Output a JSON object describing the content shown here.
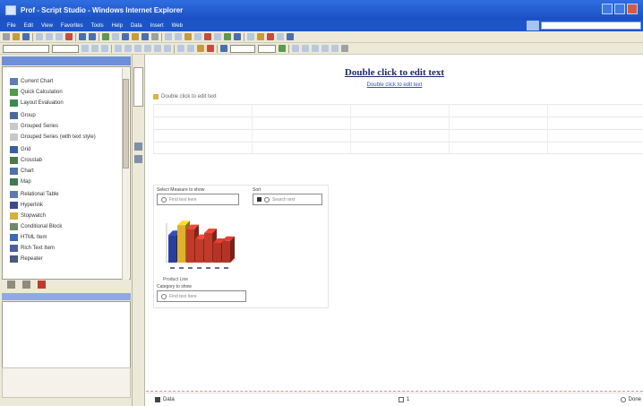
{
  "window": {
    "title": "Prof - Script Studio - Windows Internet Explorer"
  },
  "menu": {
    "items": [
      "File",
      "Edit",
      "View",
      "Favorites",
      "Tools",
      "Help",
      "Data",
      "Insert",
      "Web"
    ]
  },
  "left_panel": {
    "items": [
      "Current Chart",
      "Quick Calculation",
      "Layout Evaluation",
      "Group",
      "Grouped Series",
      "Grouped Series (with text style)",
      "Grid",
      "Crosstab",
      "Chart",
      "Map",
      "Relational Table",
      "Hyperlink",
      "Stopwatch",
      "Conditional Block",
      "HTML Item",
      "Rich Text Item",
      "Repeater"
    ]
  },
  "canvas": {
    "title": "Double click to edit text",
    "subtitle": "Double click to edit text",
    "filter_label": "Double click to edit text"
  },
  "chart_card": {
    "top_field_label": "Select Measure to show",
    "top_field_placeholder": "Find text here",
    "sort_label": "Sort",
    "sort_placeholder": "Search text",
    "caption": "Product Line",
    "bottom_field_label": "Category to show",
    "bottom_field_placeholder": "Find text here"
  },
  "status": {
    "left": "Data",
    "mid": "1",
    "right": "Done"
  },
  "chart_data": {
    "type": "bar",
    "categories": [
      "",
      "",
      "",
      "",
      "",
      "",
      ""
    ],
    "series": [
      {
        "values": [
          70,
          95,
          85,
          60,
          75,
          50,
          55
        ]
      }
    ],
    "colors": [
      "#2c3e9c",
      "#e0b12a",
      "#c23b2a",
      "#c23b2a",
      "#c23b2a",
      "#b53326",
      "#b53326"
    ],
    "ylim": [
      0,
      100
    ],
    "title": "",
    "xlabel": "",
    "ylabel": ""
  }
}
